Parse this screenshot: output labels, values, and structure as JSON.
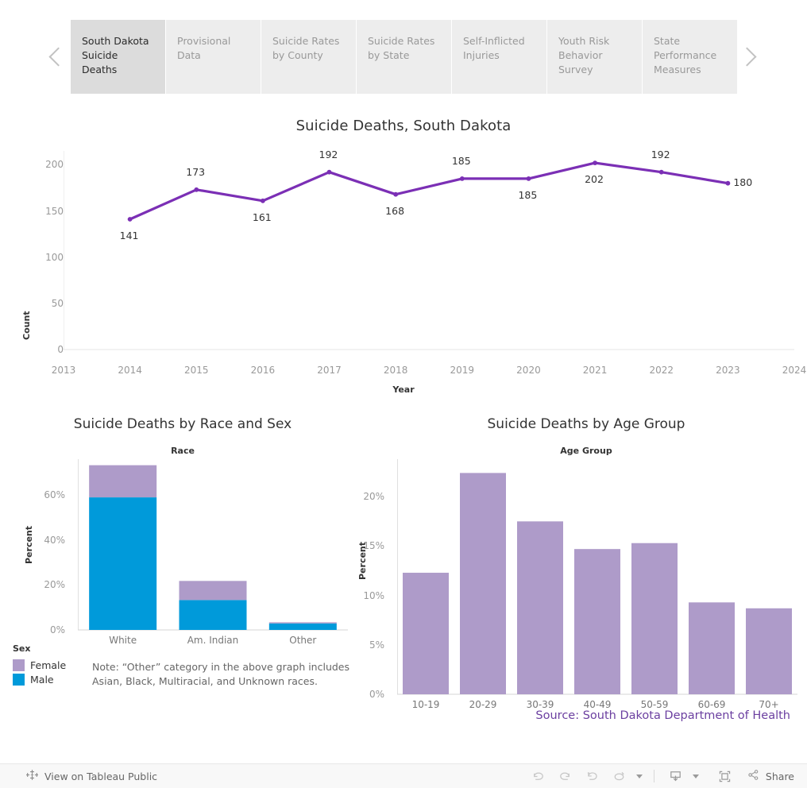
{
  "tabs": {
    "prev_icon": "chevron-left-icon",
    "next_icon": "chevron-right-icon",
    "items": [
      {
        "label": "South Dakota Suicide Deaths",
        "active": true
      },
      {
        "label": "Provisional Data",
        "active": false
      },
      {
        "label": "Suicide Rates by County",
        "active": false
      },
      {
        "label": "Suicide Rates by State",
        "active": false
      },
      {
        "label": "Self-Inflicted Injuries",
        "active": false
      },
      {
        "label": "Youth Risk Behavior Survey",
        "active": false
      },
      {
        "label": "State Performance Measures",
        "active": false
      }
    ]
  },
  "legend": {
    "title": "Sex",
    "items": [
      {
        "label": "Female",
        "color": "#ae9bc9"
      },
      {
        "label": "Male",
        "color": "#009ada"
      }
    ]
  },
  "note": "Note: “Other” category in the above graph includes Asian, Black, Multiracial, and Unknown races.",
  "source": "Source: South Dakota Department of Health",
  "toolbar": {
    "view_public_label": "View on Tableau Public",
    "view_public_icon": "tableau-logo-icon",
    "undo_icon": "undo-icon",
    "redo_icon": "redo-icon",
    "revert_icon": "revert-icon",
    "refresh_icon": "refresh-icon",
    "refresh_caret_icon": "caret-down-icon",
    "download_icon": "download-icon",
    "download_caret_icon": "caret-down-icon",
    "fullscreen_icon": "fullscreen-icon",
    "share_icon": "share-icon",
    "share_label": "Share"
  },
  "chart_data": [
    {
      "id": "line",
      "type": "line",
      "title": "Suicide Deaths, South Dakota",
      "xlabel": "Year",
      "ylabel": "Count",
      "x": [
        2014,
        2015,
        2016,
        2017,
        2018,
        2019,
        2020,
        2021,
        2022,
        2023
      ],
      "values": [
        141,
        173,
        161,
        192,
        168,
        185,
        185,
        202,
        192,
        180
      ],
      "point_labels": [
        "141",
        "173",
        "161",
        "192",
        "168",
        "185",
        "185",
        "202",
        "192",
        "180"
      ],
      "label_positions": [
        "below",
        "above",
        "below",
        "above",
        "below",
        "above",
        "below",
        "below",
        "above",
        "right"
      ],
      "xticks": [
        "2013",
        "2014",
        "2015",
        "2016",
        "2017",
        "2018",
        "2019",
        "2020",
        "2021",
        "2022",
        "2023",
        "2024"
      ],
      "xlim": [
        2013,
        2024
      ],
      "yticks": [
        "0",
        "50",
        "100",
        "150",
        "200"
      ],
      "ytick_values": [
        0,
        50,
        100,
        150,
        200
      ],
      "ylim": [
        0,
        215
      ],
      "grid": false,
      "color": "#7b2fb5",
      "legend": "none"
    },
    {
      "id": "race",
      "type": "bar",
      "title": "Suicide Deaths by Race and Sex",
      "xlabel": "Race",
      "ylabel": "Percent",
      "categories": [
        "White",
        "Am. Indian",
        "Other"
      ],
      "series": [
        {
          "name": "Male",
          "color": "#009ada",
          "values": [
            59.0,
            13.3,
            2.9
          ]
        },
        {
          "name": "Female",
          "color": "#ae9bc9",
          "values": [
            14.3,
            8.5,
            0.5
          ]
        }
      ],
      "stacked": true,
      "yticks": [
        "0%",
        "20%",
        "40%",
        "60%"
      ],
      "ytick_values": [
        0,
        20,
        40,
        60
      ],
      "ylim": [
        0,
        76
      ],
      "grid": false,
      "legend": "bottom-left"
    },
    {
      "id": "age",
      "type": "bar",
      "title": "Suicide Deaths by Age Group",
      "xlabel": "Age Group",
      "ylabel": "Percent",
      "categories": [
        "10-19",
        "20-29",
        "30-39",
        "40-49",
        "50-59",
        "60-69",
        "70+"
      ],
      "values": [
        12.3,
        22.4,
        17.5,
        14.7,
        15.3,
        9.3,
        8.7
      ],
      "color": "#ae9bc9",
      "yticks": [
        "0%",
        "5%",
        "10%",
        "15%",
        "20%"
      ],
      "ytick_values": [
        0,
        5,
        10,
        15,
        20
      ],
      "ylim": [
        0,
        23.8
      ],
      "grid": false,
      "legend": "none"
    }
  ]
}
